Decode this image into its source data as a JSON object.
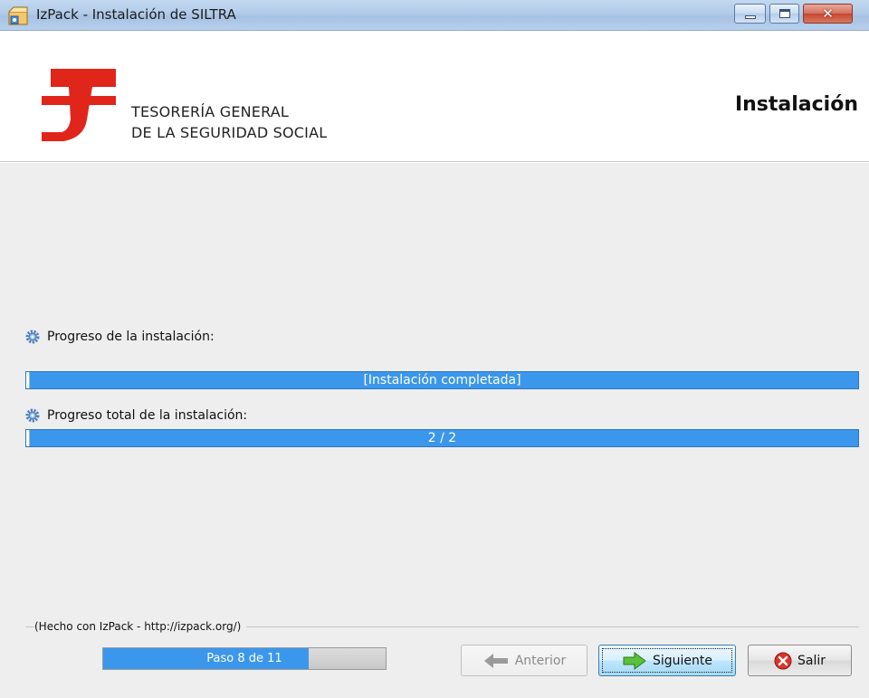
{
  "window": {
    "title": "IzPack - Instalación de  SILTRA",
    "minimize_icon": "minimize-icon",
    "maximize_icon": "maximize-icon",
    "close_label": "✕"
  },
  "header": {
    "org_line1": "TESORERÍA GENERAL",
    "org_line2": "DE LA SEGURIDAD SOCIAL",
    "title": "Instalación"
  },
  "progress": {
    "pack_label": "Progreso de la instalación:",
    "pack_text": "[Instalación completada]",
    "pack_value": 1.0,
    "total_label": "Progreso total de la instalación:",
    "total_text": "2 / 2",
    "total_value": 1.0
  },
  "footer": {
    "made_with": "(Hecho con IzPack - http://izpack.org/)",
    "step_text": "Paso 8 de 11",
    "step_current": 8,
    "step_total": 11,
    "prev_label": "Anterior",
    "next_label": "Siguiente",
    "exit_label": "Salir"
  },
  "colors": {
    "accent": "#3b97eb",
    "brand_red": "#e0251b",
    "titlebar": "#b2cbe8"
  }
}
